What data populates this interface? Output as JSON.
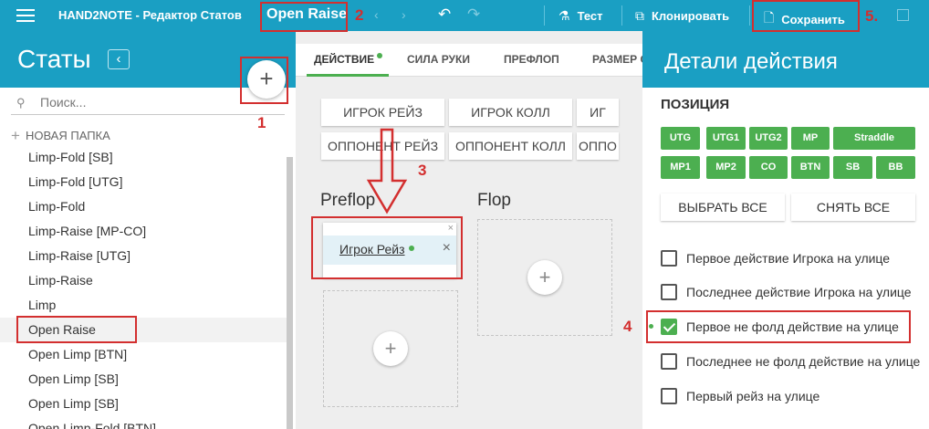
{
  "topbar": {
    "app_title": "HAND2NOTE - Редактор Статов",
    "stat_name": "Open Raise",
    "test_label": "Тест",
    "clone_label": "Клонировать",
    "save_label": "Сохранить"
  },
  "left_panel": {
    "title": "Статы",
    "search_placeholder": "Поиск...",
    "new_folder_label": "НОВАЯ ПАПКА",
    "selected_index": 7,
    "items": [
      "Limp-Fold [SB]",
      "Limp-Fold [UTG]",
      "Limp-Fold",
      "Limp-Raise [MP-CO]",
      "Limp-Raise [UTG]",
      "Limp-Raise",
      "Limp",
      "Open Raise",
      "Open Limp [BTN]",
      "Open Limp [SB]",
      "Open Limp [SB]",
      "Open Limp-Fold [BTN]"
    ]
  },
  "middle": {
    "tabs": [
      "ДЕЙСТВИЕ",
      "СИЛА РУКИ",
      "ПРЕФЛОП",
      "РАЗМЕР С"
    ],
    "action_buttons_row1": [
      "ИГРОК РЕЙЗ",
      "ИГРОК КОЛЛ",
      "ИГ"
    ],
    "action_buttons_row2": [
      "ОППОНЕНТ РЕЙЗ",
      "ОППОНЕНТ КОЛЛ",
      "ОППО"
    ],
    "street_preflop": "Preflop",
    "street_flop": "Flop",
    "condition_label": "Игрок Рейз"
  },
  "right_panel": {
    "title": "Детали действия",
    "position_title": "ПОЗИЦИЯ",
    "positions_row1": [
      "UTG",
      "UTG1",
      "UTG2",
      "MP",
      "Straddle"
    ],
    "positions_row2": [
      "MP1",
      "MP2",
      "CO",
      "BTN",
      "SB",
      "BB"
    ],
    "select_all": "ВЫБРАТЬ ВСЕ",
    "deselect_all": "СНЯТЬ ВСЕ",
    "checkboxes": [
      {
        "label": "Первое действие Игрока на улице",
        "checked": false
      },
      {
        "label": "Последнее действие Игрока на улице",
        "checked": false
      },
      {
        "label": "Первое не фолд действие на улице",
        "checked": true
      },
      {
        "label": "Последнее не фолд действие на улице",
        "checked": false
      },
      {
        "label": "Первый рейз на улице",
        "checked": false
      }
    ]
  },
  "annotations": [
    "1",
    "2",
    "3",
    "4",
    "5."
  ],
  "colors": {
    "header": "#1a9fc3",
    "accent_green": "#4caf50",
    "annotation_red": "#d32f2f"
  }
}
